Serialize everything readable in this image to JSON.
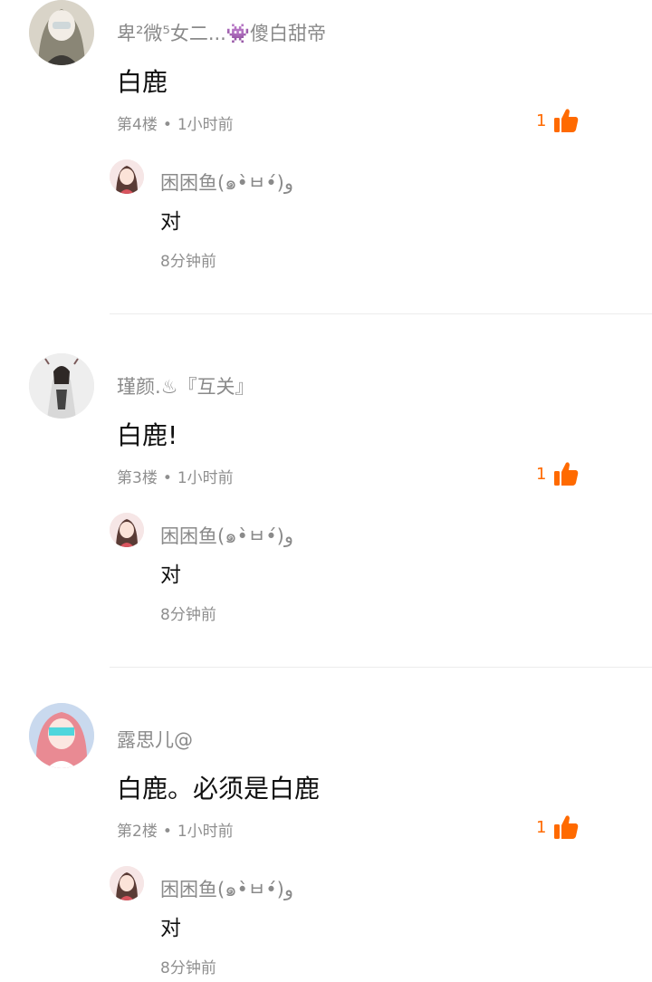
{
  "comments": [
    {
      "username": "卑²微⁵女二...👾傻白甜帝",
      "content": "白鹿",
      "floor": "第4楼",
      "time": "1小时前",
      "likes": "1",
      "reply": {
        "username": "困困鱼(๑•̀ㅂ•́)و",
        "content": "对",
        "time": "8分钟前"
      }
    },
    {
      "username": "瑾颜.♨『互关』",
      "content": "白鹿!",
      "floor": "第3楼",
      "time": "1小时前",
      "likes": "1",
      "reply": {
        "username": "困困鱼(๑•̀ㅂ•́)و",
        "content": "对",
        "time": "8分钟前"
      }
    },
    {
      "username": "露思儿@",
      "content": "白鹿。必须是白鹿",
      "floor": "第2楼",
      "time": "1小时前",
      "likes": "1",
      "reply": {
        "username": "困困鱼(๑•̀ㅂ•́)و",
        "content": "对",
        "time": "8分钟前"
      }
    }
  ],
  "icons": {
    "like": "thumbs-up-icon"
  },
  "colors": {
    "accent": "#ff6a00",
    "meta": "#8f8f8f",
    "divider": "#ececec"
  }
}
